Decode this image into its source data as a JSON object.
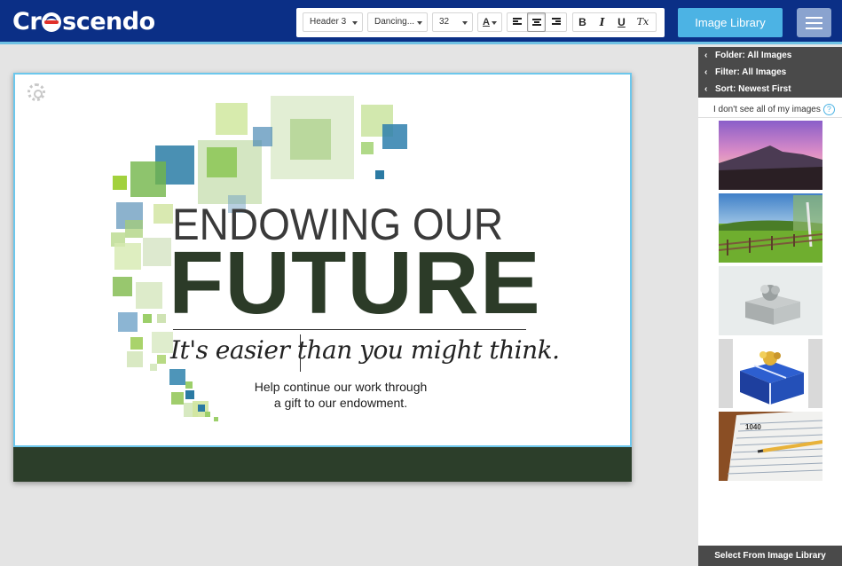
{
  "app": {
    "logo_text_left": "Cr",
    "logo_text_right": "scendo"
  },
  "toolbar": {
    "style_select": "Header 3",
    "font_select": "Dancing...",
    "size_select": "32",
    "font_color_label": "A",
    "bold": "B",
    "italic": "I",
    "underline": "U",
    "clear_format": "Tx"
  },
  "header": {
    "image_library_button": "Image Library"
  },
  "card": {
    "heading_line1": "ENDOWING OUR",
    "heading_line2": "FUTURE",
    "tagline": "It's easier than you might think.",
    "body_line1": "Help continue our work through",
    "body_line2": "a gift to our endowment."
  },
  "sidebar": {
    "folder": "Folder: All Images",
    "filter": "Filter: All Images",
    "sort": "Sort: Newest First",
    "help_text": "I don't see all of my images",
    "help_icon": "?",
    "select_button": "Select From Image Library",
    "thumbnails": [
      "mountain-sunset-image",
      "meadow-fence-image",
      "silver-gift-box-image",
      "blue-gift-box-image",
      "tax-form-image"
    ]
  },
  "colors": {
    "header_bg": "#0b2f86",
    "accent": "#4cb3e4",
    "footer_dark": "#2c3e2a",
    "sidebar_dark": "#4a4a4a"
  }
}
